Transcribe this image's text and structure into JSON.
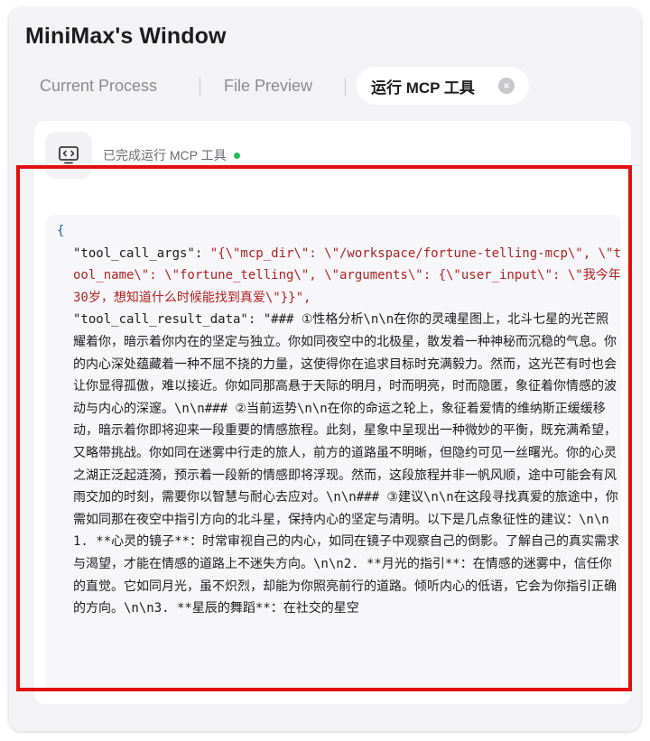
{
  "window": {
    "title": "MiniMax's Window"
  },
  "tabs": [
    {
      "label": "Current Process"
    },
    {
      "label": "File Preview"
    },
    {
      "label": "运行 MCP 工具",
      "active": true,
      "close_label": "×"
    }
  ],
  "status": {
    "text": "已完成运行 MCP 工具",
    "dot_color": "#1fbf4b"
  },
  "code": {
    "open_brace": "{",
    "args_key": "\"tool_call_args\": ",
    "args_value": "\"{\\\"mcp_dir\\\": \\\"/workspace/fortune-telling-mcp\\\", \\\"tool_name\\\": \\\"fortune_telling\\\", \\\"arguments\\\": {\\\"user_input\\\": \\\"我今年30岁，想知道什么时候能找到真爱\\\"}}\",",
    "result_key": "\"tool_call_result_data\": ",
    "result_value": "\"### ①性格分析\\n\\n在你的灵魂星图上，北斗七星的光芒照耀着你，暗示着你内在的坚定与独立。你如同夜空中的北极星，散发着一种神秘而沉稳的气息。你的内心深处蕴藏着一种不屈不挠的力量，这使得你在追求目标时充满毅力。然而，这光芒有时也会让你显得孤傲，难以接近。你如同那高悬于天际的明月，时而明亮，时而隐匿，象征着你情感的波动与内心的深邃。\\n\\n### ②当前运势\\n\\n在你的命运之轮上，象征着爱情的维纳斯正缓缓移动，暗示着你即将迎来一段重要的情感旅程。此刻，星象中呈现出一种微妙的平衡，既充满希望，又略带挑战。你如同在迷雾中行走的旅人，前方的道路虽不明晰，但隐约可见一丝曙光。你的心灵之湖正泛起涟漪，预示着一段新的情感即将浮现。然而，这段旅程并非一帆风顺，途中可能会有风雨交加的时刻，需要你以智慧与耐心去应对。\\n\\n### ③建议\\n\\n在这段寻找真爱的旅途中，你需如同那在夜空中指引方向的北斗星，保持内心的坚定与清明。以下是几点象征性的建议：\\n\\n1. **心灵的镜子**：时常审视自己的内心，如同在镜子中观察自己的倒影。了解自己的真实需求与渴望，才能在情感的道路上不迷失方向。\\n\\n2. **月光的指引**：在情感的迷雾中，信任你的直觉。它如同月光，虽不炽烈，却能为你照亮前行的道路。倾听内心的低语，它会为你指引正确的方向。\\n\\n3. **星辰的舞蹈**：在社交的星空"
  },
  "colors": {
    "highlight": "#e10f0f",
    "string": "#b02121",
    "brace": "#1a5fb4"
  },
  "icons": {
    "status": "code-window-icon"
  }
}
